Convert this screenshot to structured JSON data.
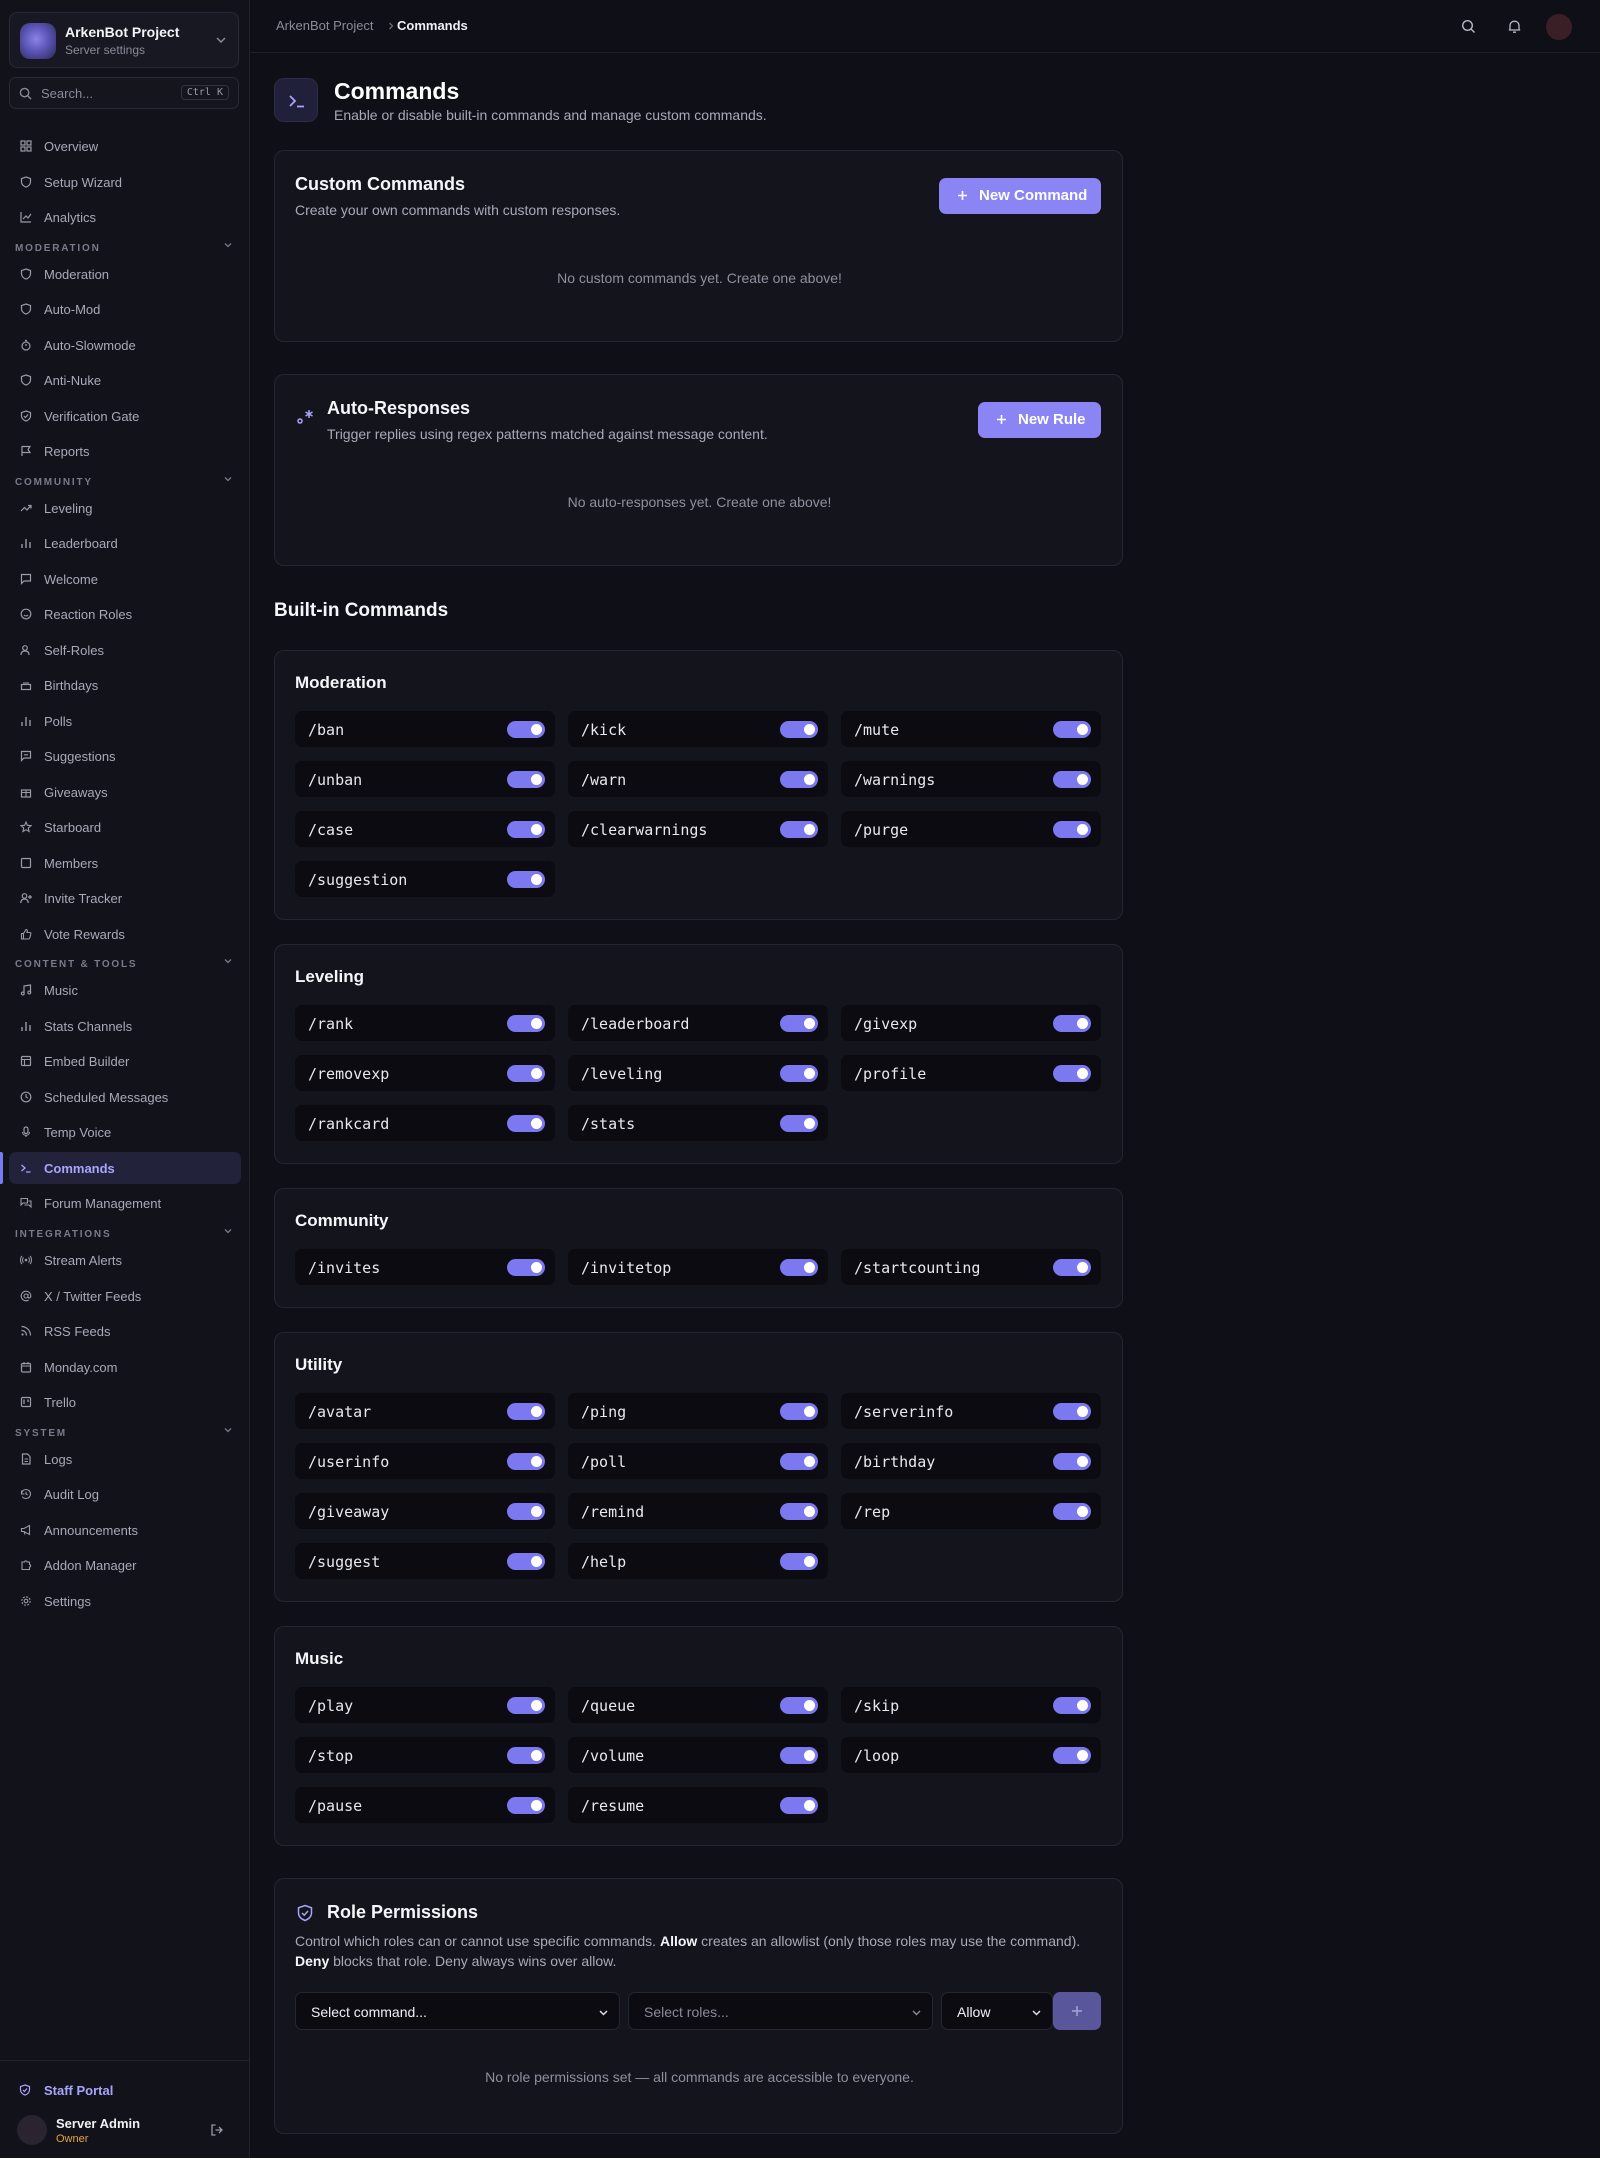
{
  "sidebar": {
    "server_name": "ArkenBot Project",
    "server_sub": "Server settings",
    "search_placeholder": "Search...",
    "search_shortcut": "Ctrl K",
    "items": {
      "overview": "Overview",
      "setup_wizard": "Setup Wizard",
      "analytics": "Analytics",
      "moderation": "Moderation",
      "auto_mod": "Auto-Mod",
      "auto_slowmode": "Auto-Slowmode",
      "anti_nuke": "Anti-Nuke",
      "verification_gate": "Verification Gate",
      "reports": "Reports",
      "leveling": "Leveling",
      "leaderboard": "Leaderboard",
      "welcome": "Welcome",
      "reaction_roles": "Reaction Roles",
      "self_roles": "Self-Roles",
      "birthdays": "Birthdays",
      "polls": "Polls",
      "suggestions": "Suggestions",
      "giveaways": "Giveaways",
      "starboard": "Starboard",
      "members": "Members",
      "invite_tracker": "Invite Tracker",
      "vote_rewards": "Vote Rewards",
      "music": "Music",
      "stats_channels": "Stats Channels",
      "embed_builder": "Embed Builder",
      "scheduled_messages": "Scheduled Messages",
      "temp_voice": "Temp Voice",
      "commands": "Commands",
      "forum_management": "Forum Management",
      "stream_alerts": "Stream Alerts",
      "twitter_feeds": "X / Twitter Feeds",
      "rss_feeds": "RSS Feeds",
      "monday": "Monday.com",
      "trello": "Trello",
      "logs": "Logs",
      "audit_log": "Audit Log",
      "announcements": "Announcements",
      "addon_manager": "Addon Manager",
      "settings": "Settings"
    },
    "sections": {
      "moderation": "MODERATION",
      "community": "COMMUNITY",
      "content_tools": "CONTENT & TOOLS",
      "integrations": "INTEGRATIONS",
      "system": "SYSTEM"
    },
    "staff_portal": "Staff Portal",
    "user_name": "Server Admin",
    "user_role": "Owner"
  },
  "topbar": {
    "breadcrumb_parent": "ArkenBot Project",
    "breadcrumb_current": "Commands"
  },
  "page": {
    "title": "Commands",
    "subtitle": "Enable or disable built-in commands and manage custom commands."
  },
  "custom_commands": {
    "title": "Custom Commands",
    "subtitle": "Create your own commands with custom responses.",
    "button": "New Command",
    "empty": "No custom commands yet. Create one above!"
  },
  "auto_responses": {
    "title": "Auto-Responses",
    "subtitle": "Trigger replies using regex patterns matched against message content.",
    "button": "New Rule",
    "empty": "No auto-responses yet. Create one above!"
  },
  "builtin": {
    "heading": "Built-in Commands",
    "groups": {
      "moderation": {
        "title": "Moderation",
        "commands": [
          "/ban",
          "/kick",
          "/mute",
          "/unban",
          "/warn",
          "/warnings",
          "/case",
          "/clearwarnings",
          "/purge",
          "/suggestion"
        ]
      },
      "leveling": {
        "title": "Leveling",
        "commands": [
          "/rank",
          "/leaderboard",
          "/givexp",
          "/removexp",
          "/leveling",
          "/profile",
          "/rankcard",
          "/stats"
        ]
      },
      "community": {
        "title": "Community",
        "commands": [
          "/invites",
          "/invitetop",
          "/startcounting"
        ]
      },
      "utility": {
        "title": "Utility",
        "commands": [
          "/avatar",
          "/ping",
          "/serverinfo",
          "/userinfo",
          "/poll",
          "/birthday",
          "/giveaway",
          "/remind",
          "/rep",
          "/suggest",
          "/help"
        ]
      },
      "music": {
        "title": "Music",
        "commands": [
          "/play",
          "/queue",
          "/skip",
          "/stop",
          "/volume",
          "/loop",
          "/pause",
          "/resume"
        ]
      }
    }
  },
  "role_permissions": {
    "title": "Role Permissions",
    "desc_1": "Control which roles can or cannot use specific commands. ",
    "allow_word": "Allow",
    "desc_2": " creates an allowlist (only those roles may use the command). ",
    "deny_word": "Deny",
    "desc_3": " blocks that role. Deny always wins over allow.",
    "command_select": "Select command...",
    "roles_select": "Select roles...",
    "mode_select": "Allow",
    "empty": "No role permissions set — all commands are accessible to everyone."
  },
  "colors": {
    "accent": "#8b84f5",
    "toggle_on": "#7c78f0",
    "owner": "#e5a53a"
  }
}
